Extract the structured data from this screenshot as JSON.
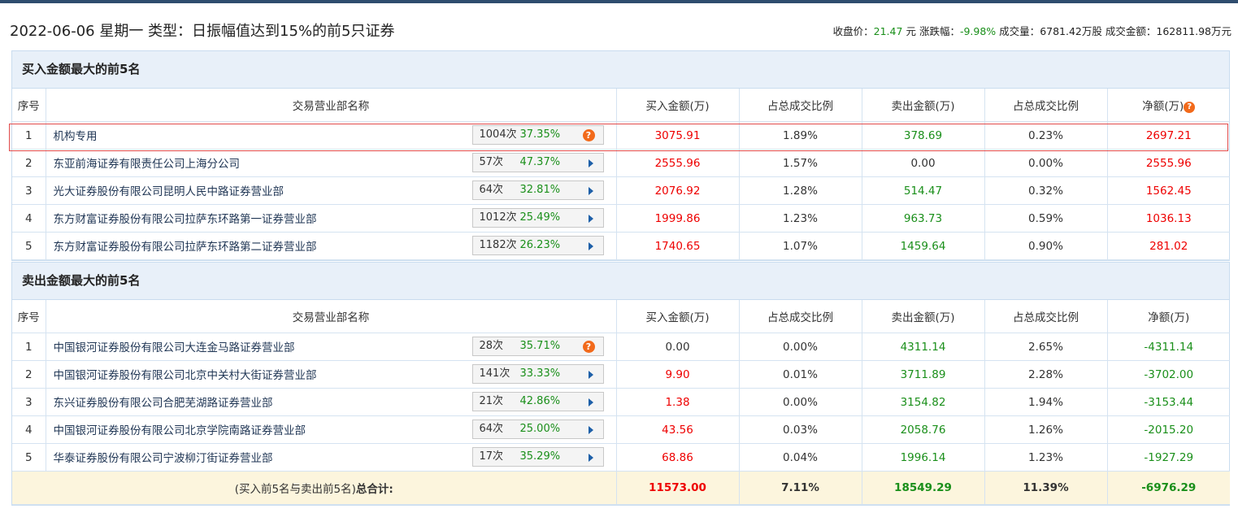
{
  "header": {
    "title": "2022-06-06 星期一 类型：日振幅值达到15%的前5只证券",
    "close_label": "收盘价：",
    "close_value": "21.47",
    "close_unit": "元",
    "change_label": "涨跌幅：",
    "change_value": "-9.98%",
    "volume_label": "成交量：",
    "volume_value": "6781.42万股",
    "turnover_label": "成交金额：",
    "turnover_value": "162811.98万元"
  },
  "columns": [
    "序号",
    "交易营业部名称",
    "买入金额(万)",
    "占总成交比例",
    "卖出金额(万)",
    "占总成交比例",
    "净额(万)"
  ],
  "buy_section": {
    "title": "买入金额最大的前5名",
    "rows": [
      {
        "idx": "1",
        "name": "机构专用",
        "times": "1004次",
        "pct": "37.35%",
        "buy": "3075.91",
        "buy_ratio": "1.89%",
        "sell": "378.69",
        "sell_ratio": "0.23%",
        "net": "2697.21"
      },
      {
        "idx": "2",
        "name": "东亚前海证券有限责任公司上海分公司",
        "times": "57次",
        "pct": "47.37%",
        "buy": "2555.96",
        "buy_ratio": "1.57%",
        "sell": "0.00",
        "sell_ratio": "0.00%",
        "net": "2555.96"
      },
      {
        "idx": "3",
        "name": "光大证券股份有限公司昆明人民中路证券营业部",
        "times": "64次",
        "pct": "32.81%",
        "buy": "2076.92",
        "buy_ratio": "1.28%",
        "sell": "514.47",
        "sell_ratio": "0.32%",
        "net": "1562.45"
      },
      {
        "idx": "4",
        "name": "东方财富证券股份有限公司拉萨东环路第一证券营业部",
        "times": "1012次",
        "pct": "25.49%",
        "buy": "1999.86",
        "buy_ratio": "1.23%",
        "sell": "963.73",
        "sell_ratio": "0.59%",
        "net": "1036.13"
      },
      {
        "idx": "5",
        "name": "东方财富证券股份有限公司拉萨东环路第二证券营业部",
        "times": "1182次",
        "pct": "26.23%",
        "buy": "1740.65",
        "buy_ratio": "1.07%",
        "sell": "1459.64",
        "sell_ratio": "0.90%",
        "net": "281.02"
      }
    ]
  },
  "sell_section": {
    "title": "卖出金额最大的前5名",
    "rows": [
      {
        "idx": "1",
        "name": "中国银河证券股份有限公司大连金马路证券营业部",
        "times": "28次",
        "pct": "35.71%",
        "buy": "0.00",
        "buy_ratio": "0.00%",
        "sell": "4311.14",
        "sell_ratio": "2.65%",
        "net": "-4311.14"
      },
      {
        "idx": "2",
        "name": "中国银河证券股份有限公司北京中关村大街证券营业部",
        "times": "141次",
        "pct": "33.33%",
        "buy": "9.90",
        "buy_ratio": "0.01%",
        "sell": "3711.89",
        "sell_ratio": "2.28%",
        "net": "-3702.00"
      },
      {
        "idx": "3",
        "name": "东兴证券股份有限公司合肥芜湖路证券营业部",
        "times": "21次",
        "pct": "42.86%",
        "buy": "1.38",
        "buy_ratio": "0.00%",
        "sell": "3154.82",
        "sell_ratio": "1.94%",
        "net": "-3153.44"
      },
      {
        "idx": "4",
        "name": "中国银河证券股份有限公司北京学院南路证券营业部",
        "times": "64次",
        "pct": "25.00%",
        "buy": "43.56",
        "buy_ratio": "0.03%",
        "sell": "2058.76",
        "sell_ratio": "1.26%",
        "net": "-2015.20"
      },
      {
        "idx": "5",
        "name": "华泰证券股份有限公司宁波柳汀街证券营业部",
        "times": "17次",
        "pct": "35.29%",
        "buy": "68.86",
        "buy_ratio": "0.04%",
        "sell": "1996.14",
        "sell_ratio": "1.23%",
        "net": "-1927.29"
      }
    ]
  },
  "total": {
    "label_prefix": "(买入前5名与卖出前5名)",
    "label_bold": "总合计:",
    "buy": "11573.00",
    "buy_ratio": "7.11%",
    "sell": "18549.29",
    "sell_ratio": "11.39%",
    "net": "-6976.29"
  },
  "icons": {
    "question": "?"
  },
  "colors": {
    "positive": "#e00000",
    "negative": "#1a8f1a",
    "header_bg": "#e8f0f9",
    "total_bg": "#fcf5dd"
  }
}
